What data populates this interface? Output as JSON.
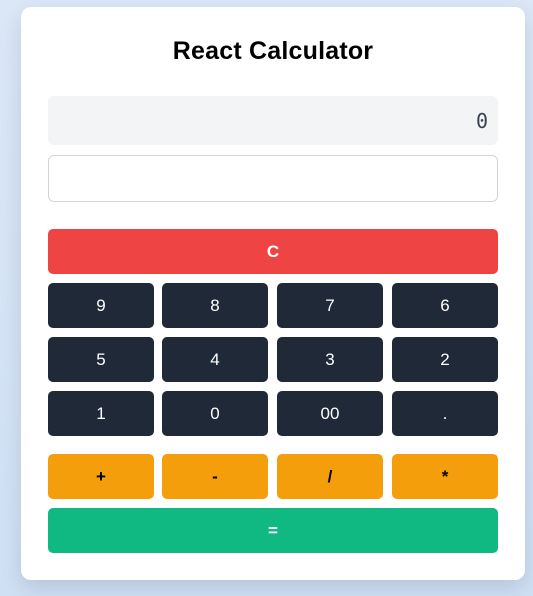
{
  "app": {
    "title": "React Calculator"
  },
  "display": {
    "value": "0"
  },
  "input": {
    "value": "",
    "placeholder": ""
  },
  "buttons": {
    "clear": "C",
    "digits_row1": [
      "9",
      "8",
      "7",
      "6"
    ],
    "digits_row2": [
      "5",
      "4",
      "3",
      "2"
    ],
    "digits_row3": [
      "1",
      "0",
      "00",
      "."
    ],
    "operators": [
      "+",
      "-",
      "/",
      "*"
    ],
    "equals": "="
  },
  "colors": {
    "clear": "#ef4444",
    "digit": "#1f2937",
    "operator": "#f59e0b",
    "equals": "#10b981",
    "display_bg": "#f3f4f6"
  }
}
